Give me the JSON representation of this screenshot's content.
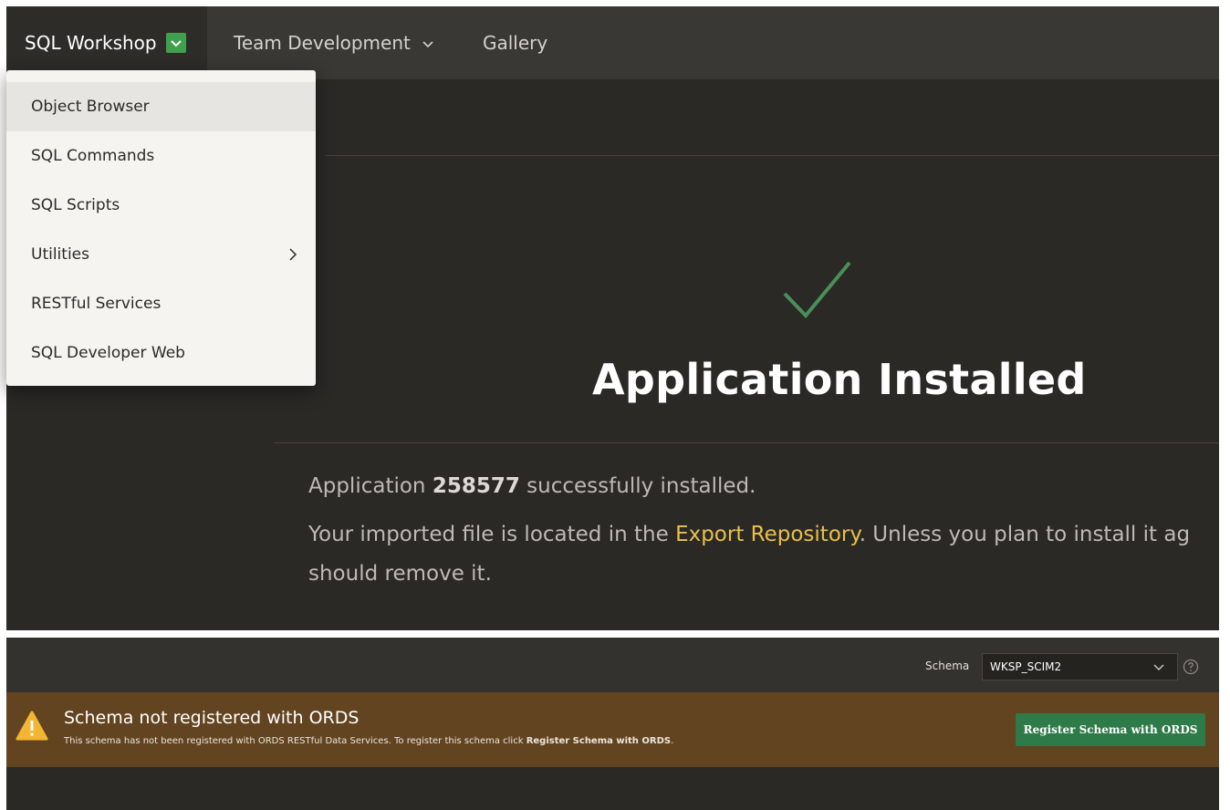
{
  "nav": {
    "sql_workshop": "SQL Workshop",
    "team_development": "Team Development",
    "gallery": "Gallery"
  },
  "dropdown": {
    "items": [
      {
        "label": "Object Browser"
      },
      {
        "label": "SQL Commands"
      },
      {
        "label": "SQL Scripts"
      },
      {
        "label": "Utilities"
      },
      {
        "label": "RESTful Services"
      },
      {
        "label": "SQL Developer Web"
      }
    ]
  },
  "page": {
    "title": "Application Installed",
    "app_prefix": "Application",
    "app_id": "258577",
    "app_suffix": "successfully installed.",
    "line2_prefix": "Your imported file is located in the",
    "line2_link": "Export Repository",
    "line2_suffix": ". Unless you plan to install it ag",
    "line3": "should remove it."
  },
  "schema": {
    "label": "Schema",
    "value": "WKSP_SCIM2"
  },
  "warning": {
    "title": "Schema not registered with ORDS",
    "desc_prefix": "This schema has not been registered with ORDS RESTful Data Services. To register this schema click",
    "desc_bold": "Register Schema with ORDS",
    "desc_suffix": ".",
    "button": "Register Schema with ORDS"
  },
  "colors": {
    "accent_green": "#3fa14d",
    "link_yellow": "#e8c04a",
    "warning_bg": "#624421",
    "button_green": "#2e7a48"
  },
  "icons": {
    "nav_badge": "check-icon",
    "success": "checkmark-icon",
    "warning": "warning-triangle-icon",
    "help": "help-circle-icon"
  }
}
